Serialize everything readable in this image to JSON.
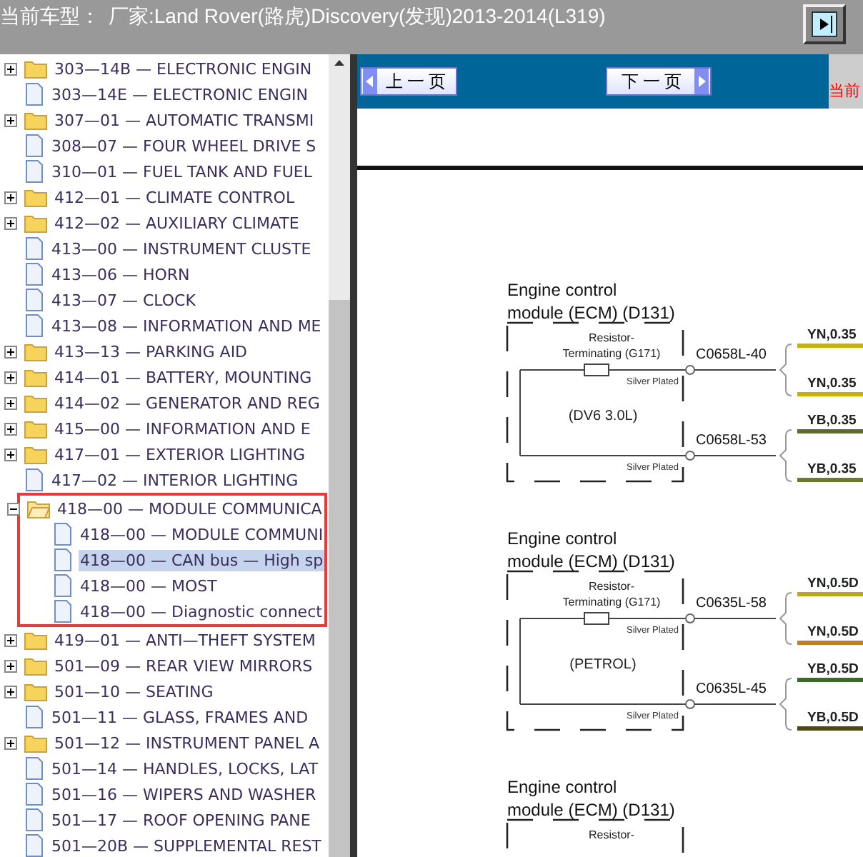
{
  "header": {
    "label": "当前车型：",
    "value": "厂家:Land Rover(路虎)Discovery(发现)2013-2014(L319)"
  },
  "tree": [
    {
      "label": "303—14B — ELECTRONIC ENGIN",
      "kind": "folder",
      "expanded": false,
      "selected": false,
      "highlighted": false
    },
    {
      "label": "303—14E — ELECTRONIC ENGIN",
      "kind": "document",
      "selected": false,
      "highlighted": false
    },
    {
      "label": "307—01 — AUTOMATIC TRANSMI",
      "kind": "folder",
      "expanded": false,
      "selected": false,
      "highlighted": false
    },
    {
      "label": "308—07 — FOUR WHEEL DRIVE S",
      "kind": "document",
      "selected": false,
      "highlighted": false
    },
    {
      "label": "310—01 — FUEL TANK AND FUEL",
      "kind": "document",
      "selected": false,
      "highlighted": false
    },
    {
      "label": "412—01 — CLIMATE CONTROL",
      "kind": "folder",
      "expanded": false,
      "selected": false,
      "highlighted": false
    },
    {
      "label": "412—02 — AUXILIARY CLIMATE",
      "kind": "folder",
      "expanded": false,
      "selected": false,
      "highlighted": false
    },
    {
      "label": "413—00 — INSTRUMENT CLUSTE",
      "kind": "document",
      "selected": false,
      "highlighted": false
    },
    {
      "label": "413—06 — HORN",
      "kind": "document",
      "selected": false,
      "highlighted": false
    },
    {
      "label": "413—07 — CLOCK",
      "kind": "document",
      "selected": false,
      "highlighted": false
    },
    {
      "label": "413—08 — INFORMATION AND ME",
      "kind": "document",
      "selected": false,
      "highlighted": false
    },
    {
      "label": "413—13 — PARKING AID",
      "kind": "folder",
      "expanded": false,
      "selected": false,
      "highlighted": false
    },
    {
      "label": "414—01 — BATTERY, MOUNTING",
      "kind": "folder",
      "expanded": false,
      "selected": false,
      "highlighted": false
    },
    {
      "label": "414—02 — GENERATOR AND REG",
      "kind": "folder",
      "expanded": false,
      "selected": false,
      "highlighted": false
    },
    {
      "label": "415—00 — INFORMATION AND E",
      "kind": "folder",
      "expanded": false,
      "selected": false,
      "highlighted": false
    },
    {
      "label": "417—01 — EXTERIOR LIGHTING",
      "kind": "folder",
      "expanded": false,
      "selected": false,
      "highlighted": false
    },
    {
      "label": "417—02 — INTERIOR LIGHTING",
      "kind": "document",
      "selected": false,
      "highlighted": false
    },
    {
      "label": "418—00 — MODULE COMMUNICA",
      "kind": "folder",
      "expanded": true,
      "selected": false,
      "highlighted": true,
      "children": [
        {
          "label": "418—00 — MODULE COMMUNI",
          "kind": "document",
          "selected": false
        },
        {
          "label": "418—00 — CAN bus — High sp",
          "kind": "document",
          "selected": true
        },
        {
          "label": "418—00 — MOST",
          "kind": "document",
          "selected": false
        },
        {
          "label": "418—00 — Diagnostic connect",
          "kind": "document",
          "selected": false
        }
      ]
    },
    {
      "label": "419—01 — ANTI—THEFT SYSTEM",
      "kind": "folder",
      "expanded": false,
      "selected": false,
      "highlighted": false
    },
    {
      "label": "501—09 — REAR VIEW MIRRORS",
      "kind": "folder",
      "expanded": false,
      "selected": false,
      "highlighted": false
    },
    {
      "label": "501—10 — SEATING",
      "kind": "folder",
      "expanded": false,
      "selected": false,
      "highlighted": false
    },
    {
      "label": "501—11 — GLASS, FRAMES AND",
      "kind": "document",
      "selected": false,
      "highlighted": false
    },
    {
      "label": "501—12 — INSTRUMENT PANEL A",
      "kind": "folder",
      "expanded": false,
      "selected": false,
      "highlighted": false
    },
    {
      "label": "501—14 — HANDLES, LOCKS, LAT",
      "kind": "document",
      "selected": false,
      "highlighted": false
    },
    {
      "label": "501—16 — WIPERS AND WASHER",
      "kind": "document",
      "selected": false,
      "highlighted": false
    },
    {
      "label": "501—17 — ROOF OPENING PANE",
      "kind": "document",
      "selected": false,
      "highlighted": false
    },
    {
      "label": "501—20B — SUPPLEMENTAL REST",
      "kind": "document",
      "selected": false,
      "highlighted": false
    }
  ],
  "toolbar": {
    "prev": "上一页",
    "next": "下一页",
    "current": "当前"
  },
  "diagrams": [
    {
      "title": [
        "Engine control",
        "module (ECM) (D131)"
      ],
      "resistor_label": [
        "Resistor-",
        "Terminating (G171)"
      ],
      "variant": "(DV6 3.0L)",
      "connectors": [
        {
          "label": "C0658L-40",
          "plating": "Silver Plated",
          "wires": [
            {
              "label": "YN,0.35",
              "color": "#c8b400"
            },
            {
              "label": "YN,0.35",
              "color": "#c8b400"
            }
          ]
        },
        {
          "label": "C0658L-53",
          "plating": "Silver Plated",
          "wires": [
            {
              "label": "YB,0.35",
              "color": "#5a6a30"
            },
            {
              "label": "YB,0.35",
              "color": "#6a7a30"
            }
          ]
        }
      ]
    },
    {
      "title": [
        "Engine control",
        "module (ECM) (D131)"
      ],
      "resistor_label": [
        "Resistor-",
        "Terminating (G171)"
      ],
      "variant": "(PETROL)",
      "connectors": [
        {
          "label": "C0635L-58",
          "plating": "Silver Plated",
          "wires": [
            {
              "label": "YN,0.5D",
              "color": "#b8a820"
            },
            {
              "label": "YN,0.5D",
              "color": "#c08020"
            }
          ]
        },
        {
          "label": "C0635L-45",
          "plating": "Silver Plated",
          "wires": [
            {
              "label": "YB,0.5D",
              "color": "#3c6a28"
            },
            {
              "label": "YB,0.5D",
              "color": "#4a4a10"
            }
          ]
        }
      ]
    },
    {
      "title": [
        "Engine control",
        "module (ECM) (D131)"
      ],
      "resistor_label": [
        "Resistor-"
      ]
    }
  ]
}
